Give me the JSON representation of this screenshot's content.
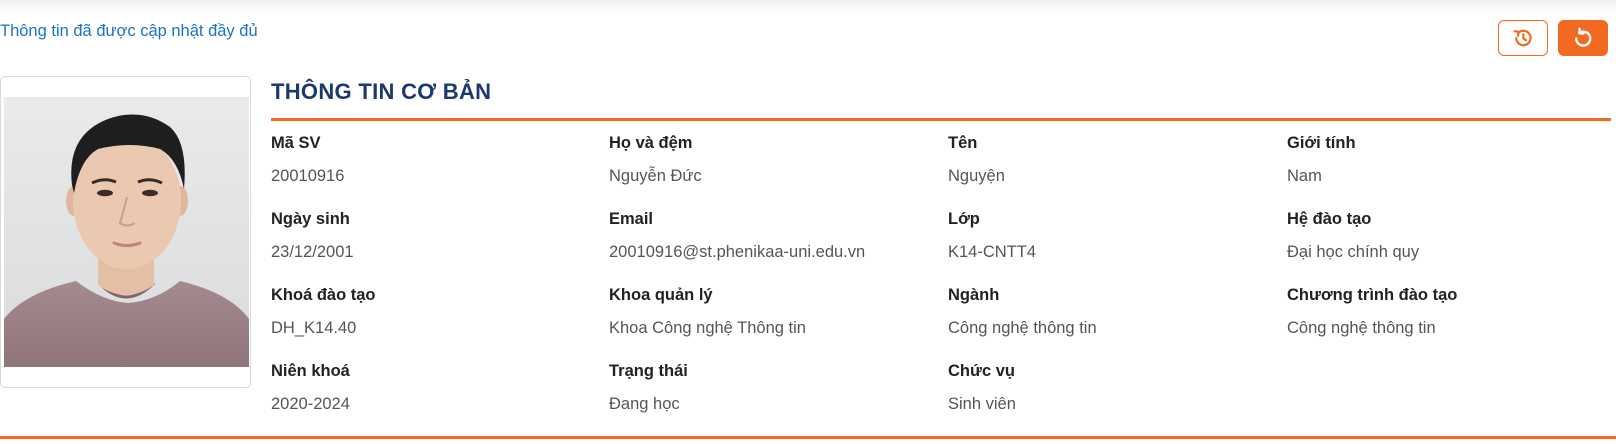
{
  "status_message": "Thông tin đã được cập nhật đầy đủ",
  "toolbar": {
    "history_icon": "history-icon",
    "reset_icon": "reset-icon",
    "accent_color": "#f26a22"
  },
  "profile": {
    "photo_icon": "student-photo"
  },
  "section": {
    "title": "THÔNG TIN CƠ BẢN",
    "title_color": "#1b3a6b"
  },
  "fields": [
    {
      "label": "Mã SV",
      "value": "20010916"
    },
    {
      "label": "Họ và đệm",
      "value": "Nguyễn Đức"
    },
    {
      "label": "Tên",
      "value": "Nguyện"
    },
    {
      "label": "Giới tính",
      "value": "Nam"
    },
    {
      "label": "Ngày sinh",
      "value": "23/12/2001"
    },
    {
      "label": "Email",
      "value": "20010916@st.phenikaa-uni.edu.vn"
    },
    {
      "label": "Lớp",
      "value": "K14-CNTT4"
    },
    {
      "label": "Hệ đào tạo",
      "value": "Đại học chính quy"
    },
    {
      "label": "Khoá đào tạo",
      "value": "DH_K14.40"
    },
    {
      "label": "Khoa quản lý",
      "value": "Khoa Công nghệ Thông tin"
    },
    {
      "label": "Ngành",
      "value": "Công nghệ thông tin"
    },
    {
      "label": "Chương trình đào tạo",
      "value": "Công nghệ thông tin"
    },
    {
      "label": "Niên khoá",
      "value": "2020-2024"
    },
    {
      "label": "Trạng thái",
      "value": "Đang học"
    },
    {
      "label": "Chức vụ",
      "value": "Sinh viên"
    }
  ]
}
